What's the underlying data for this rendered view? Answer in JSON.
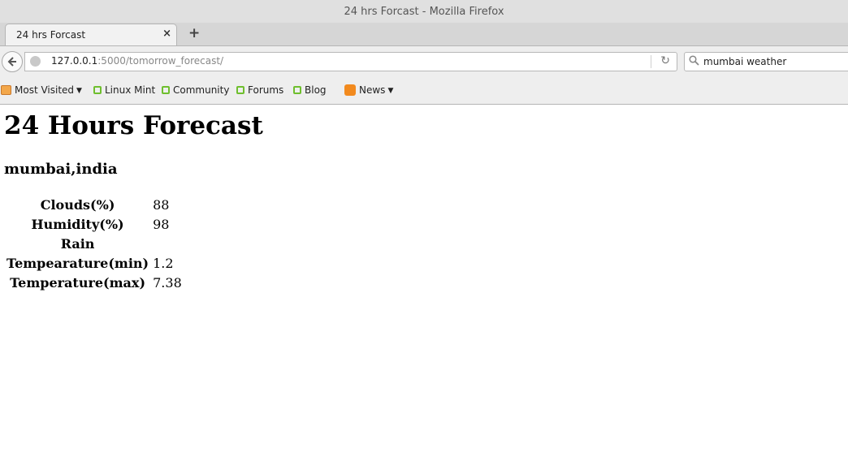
{
  "window": {
    "title": "24 hrs Forcast - Mozilla Firefox"
  },
  "tabs": [
    {
      "label": "24 hrs Forcast",
      "close_glyph": "×"
    }
  ],
  "new_tab_glyph": "+",
  "navbar": {
    "back_glyph": "🡐",
    "url_host": "127.0.0.1",
    "url_path": ":5000/tomorrow_forecast/",
    "reload_glyph": "↻",
    "search_value": "mumbai weather"
  },
  "bookmarks": [
    {
      "label": "Most Visited",
      "icon": "folder-icon",
      "has_dropdown": true
    },
    {
      "label": "Linux Mint",
      "icon": "mint-icon"
    },
    {
      "label": "Community",
      "icon": "mint-icon"
    },
    {
      "label": "Forums",
      "icon": "mint-icon"
    },
    {
      "label": "Blog",
      "icon": "mint-icon"
    },
    {
      "label": "News",
      "icon": "rss-icon",
      "has_dropdown": true
    }
  ],
  "page": {
    "title": "24 Hours Forecast",
    "location": "mumbai,india",
    "rows": [
      {
        "label": "Clouds(%)",
        "value": "88"
      },
      {
        "label": "Humidity(%)",
        "value": "98"
      },
      {
        "label": "Rain",
        "value": ""
      },
      {
        "label": "Tempearature(min)",
        "value": "1.2"
      },
      {
        "label": "Temperature(max)",
        "value": "7.38"
      }
    ]
  },
  "colors": {
    "mint_green": "#6fbf2e",
    "rss_orange": "#f28a1e"
  }
}
